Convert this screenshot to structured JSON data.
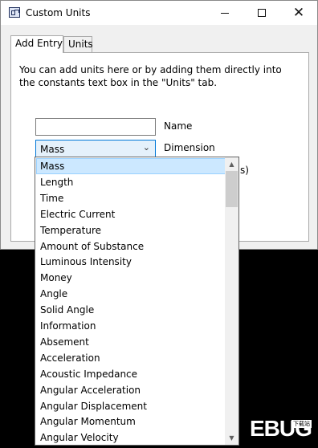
{
  "window": {
    "title": "Custom Units",
    "minimize_glyph": "",
    "maximize_glyph": "",
    "close_glyph": "✕"
  },
  "tabs": [
    {
      "label": "Add Entry",
      "active": true
    },
    {
      "label": "Units",
      "active": false
    }
  ],
  "add_entry": {
    "description": "You can add units here or by adding them directly into the constants text box in the \"Units\" tab.",
    "name_value": "",
    "name_label": "Name",
    "dimension_value": "Mass",
    "dimension_label": "Dimension",
    "partial_hidden_text": "s)"
  },
  "dimension_options": [
    "Mass",
    "Length",
    "Time",
    "Electric Current",
    "Temperature",
    "Amount of Substance",
    "Luminous Intensity",
    "Money",
    "Angle",
    "Solid Angle",
    "Information",
    "Absement",
    "Acceleration",
    "Acoustic Impedance",
    "Angular Acceleration",
    "Angular Displacement",
    "Angular Momentum",
    "Angular Velocity"
  ],
  "selected_option": "Mass",
  "watermark": {
    "text": "EBUG",
    "badge": "下载站"
  },
  "colors": {
    "selection_bg": "#cce8ff",
    "selection_border": "#99d1ff",
    "window_bg": "#f0f0f0",
    "desktop_bg": "#000000"
  },
  "icons": {
    "app": "calculator-icon",
    "chevron": "chevron-down-icon",
    "scroll_up": "arrow-up-icon",
    "scroll_down": "arrow-down-icon"
  }
}
